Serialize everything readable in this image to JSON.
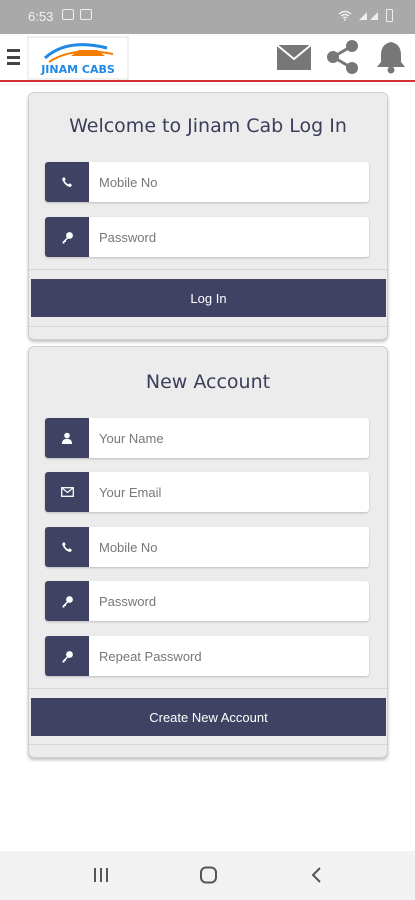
{
  "status_bar": {
    "time": "6:53"
  },
  "header": {
    "logo_text": "JINAM CABS",
    "brand_color": "#1e88e5"
  },
  "login": {
    "title": "Welcome to Jinam Cab Log In",
    "mobile_placeholder": "Mobile No",
    "password_placeholder": "Password",
    "button_label": "Log In"
  },
  "new_account": {
    "title": "New Account",
    "name_placeholder": "Your Name",
    "email_placeholder": "Your Email",
    "mobile_placeholder": "Mobile No",
    "password_placeholder": "Password",
    "repeat_password_placeholder": "Repeat Password",
    "button_label": "Create New Account"
  },
  "icons": [
    "menu-icon",
    "mail-icon",
    "share-icon",
    "bell-icon",
    "phone-icon",
    "key-icon",
    "user-icon",
    "envelope-icon"
  ],
  "colors": {
    "accent": "#3f4263",
    "header_underline": "#d32f2f"
  }
}
